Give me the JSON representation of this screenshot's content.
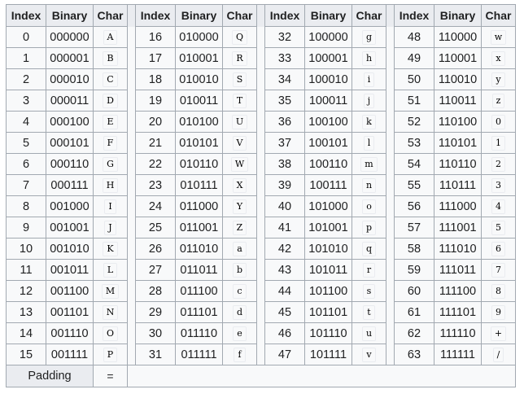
{
  "headers": [
    "Index",
    "Binary",
    "Char"
  ],
  "groups": [
    [
      {
        "index": "0",
        "binary": "000000",
        "char": "A"
      },
      {
        "index": "1",
        "binary": "000001",
        "char": "B"
      },
      {
        "index": "2",
        "binary": "000010",
        "char": "C"
      },
      {
        "index": "3",
        "binary": "000011",
        "char": "D"
      },
      {
        "index": "4",
        "binary": "000100",
        "char": "E"
      },
      {
        "index": "5",
        "binary": "000101",
        "char": "F"
      },
      {
        "index": "6",
        "binary": "000110",
        "char": "G"
      },
      {
        "index": "7",
        "binary": "000111",
        "char": "H"
      },
      {
        "index": "8",
        "binary": "001000",
        "char": "I"
      },
      {
        "index": "9",
        "binary": "001001",
        "char": "J"
      },
      {
        "index": "10",
        "binary": "001010",
        "char": "K"
      },
      {
        "index": "11",
        "binary": "001011",
        "char": "L"
      },
      {
        "index": "12",
        "binary": "001100",
        "char": "M"
      },
      {
        "index": "13",
        "binary": "001101",
        "char": "N"
      },
      {
        "index": "14",
        "binary": "001110",
        "char": "O"
      },
      {
        "index": "15",
        "binary": "001111",
        "char": "P"
      }
    ],
    [
      {
        "index": "16",
        "binary": "010000",
        "char": "Q"
      },
      {
        "index": "17",
        "binary": "010001",
        "char": "R"
      },
      {
        "index": "18",
        "binary": "010010",
        "char": "S"
      },
      {
        "index": "19",
        "binary": "010011",
        "char": "T"
      },
      {
        "index": "20",
        "binary": "010100",
        "char": "U"
      },
      {
        "index": "21",
        "binary": "010101",
        "char": "V"
      },
      {
        "index": "22",
        "binary": "010110",
        "char": "W"
      },
      {
        "index": "23",
        "binary": "010111",
        "char": "X"
      },
      {
        "index": "24",
        "binary": "011000",
        "char": "Y"
      },
      {
        "index": "25",
        "binary": "011001",
        "char": "Z"
      },
      {
        "index": "26",
        "binary": "011010",
        "char": "a"
      },
      {
        "index": "27",
        "binary": "011011",
        "char": "b"
      },
      {
        "index": "28",
        "binary": "011100",
        "char": "c"
      },
      {
        "index": "29",
        "binary": "011101",
        "char": "d"
      },
      {
        "index": "30",
        "binary": "011110",
        "char": "e"
      },
      {
        "index": "31",
        "binary": "011111",
        "char": "f"
      }
    ],
    [
      {
        "index": "32",
        "binary": "100000",
        "char": "g"
      },
      {
        "index": "33",
        "binary": "100001",
        "char": "h"
      },
      {
        "index": "34",
        "binary": "100010",
        "char": "i"
      },
      {
        "index": "35",
        "binary": "100011",
        "char": "j"
      },
      {
        "index": "36",
        "binary": "100100",
        "char": "k"
      },
      {
        "index": "37",
        "binary": "100101",
        "char": "l"
      },
      {
        "index": "38",
        "binary": "100110",
        "char": "m"
      },
      {
        "index": "39",
        "binary": "100111",
        "char": "n"
      },
      {
        "index": "40",
        "binary": "101000",
        "char": "o"
      },
      {
        "index": "41",
        "binary": "101001",
        "char": "p"
      },
      {
        "index": "42",
        "binary": "101010",
        "char": "q"
      },
      {
        "index": "43",
        "binary": "101011",
        "char": "r"
      },
      {
        "index": "44",
        "binary": "101100",
        "char": "s"
      },
      {
        "index": "45",
        "binary": "101101",
        "char": "t"
      },
      {
        "index": "46",
        "binary": "101110",
        "char": "u"
      },
      {
        "index": "47",
        "binary": "101111",
        "char": "v"
      }
    ],
    [
      {
        "index": "48",
        "binary": "110000",
        "char": "w"
      },
      {
        "index": "49",
        "binary": "110001",
        "char": "x"
      },
      {
        "index": "50",
        "binary": "110010",
        "char": "y"
      },
      {
        "index": "51",
        "binary": "110011",
        "char": "z"
      },
      {
        "index": "52",
        "binary": "110100",
        "char": "0"
      },
      {
        "index": "53",
        "binary": "110101",
        "char": "1"
      },
      {
        "index": "54",
        "binary": "110110",
        "char": "2"
      },
      {
        "index": "55",
        "binary": "110111",
        "char": "3"
      },
      {
        "index": "56",
        "binary": "111000",
        "char": "4"
      },
      {
        "index": "57",
        "binary": "111001",
        "char": "5"
      },
      {
        "index": "58",
        "binary": "111010",
        "char": "6"
      },
      {
        "index": "59",
        "binary": "111011",
        "char": "7"
      },
      {
        "index": "60",
        "binary": "111100",
        "char": "8"
      },
      {
        "index": "61",
        "binary": "111101",
        "char": "9"
      },
      {
        "index": "62",
        "binary": "111110",
        "char": "+"
      },
      {
        "index": "63",
        "binary": "111111",
        "char": "/"
      }
    ]
  ],
  "padding": {
    "label": "Padding",
    "char": "="
  }
}
